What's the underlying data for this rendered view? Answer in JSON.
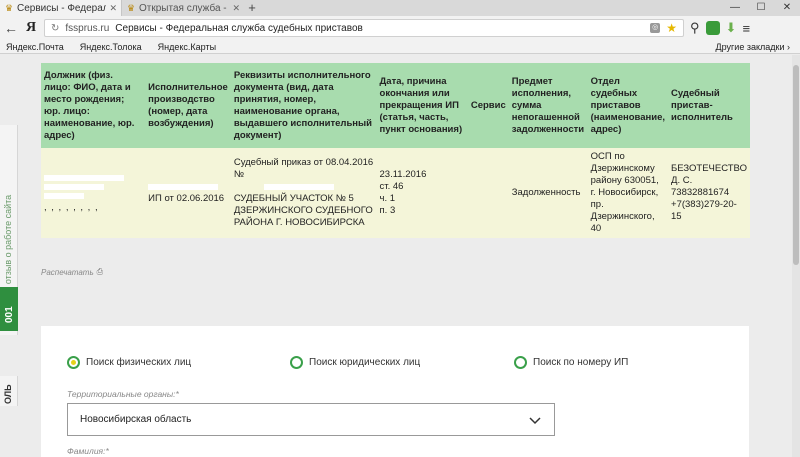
{
  "browser": {
    "tabs": [
      {
        "title": "Сервисы - Федеральная",
        "active": true
      },
      {
        "title": "Открытая служба - Федер",
        "active": false
      }
    ],
    "new_tab": "+",
    "window_controls": [
      "—",
      "☐",
      "✕"
    ],
    "address": {
      "domain": "fssprus.ru",
      "title": "Сервисы - Федеральная служба судебных приставов"
    },
    "bookmarks": [
      "Яндекс.Почта",
      "Яндекс.Толока",
      "Яндекс.Карты"
    ],
    "other_bookmarks": "Другие закладки"
  },
  "results": {
    "headers": [
      "Должник (физ. лицо: ФИО, дата и место рождения; юр. лицо: наименование, юр. адрес)",
      "Исполнительное производство (номер, дата возбуждения)",
      "Реквизиты исполнительного документа (вид, дата принятия, номер, наименование органа, выдавшего исполнительный документ)",
      "Дата, причина окончания или прекращения ИП (статья, часть, пункт основания)",
      "Сервис",
      "Предмет исполнения, сумма непогашенной задолженности",
      "Отдел судебных приставов (наименование, адрес)",
      "Судебный пристав-исполнитель"
    ],
    "row": {
      "debtor_tail": ", , , , , , , ,",
      "proceeding": "ИП от 02.06.2016",
      "document_line1": "Судебный приказ от 08.04.2016 №",
      "document_line2": "СУДЕБНЫЙ УЧАСТОК № 5 ДЗЕРЖИНСКОГО СУДЕБНОГО РАЙОНА Г. НОВОСИБИРСКА",
      "end_date": "23.11.2016",
      "end_article": "ст. 46",
      "end_part": "ч. 1",
      "end_point": "п. 3",
      "service": "",
      "subject": "Задолженность",
      "department": "ОСП по Дзержинскому району 630051, г. Новосибирск, пр. Дзержинского, 40",
      "bailiff": "БЕЗОТЕЧЕСТВО Д. С. 73832881674 +7(383)279-20-15"
    }
  },
  "print_label": "Распечатать",
  "feedback_tab": "Оставьте отзыв о работе сайта",
  "counter": "001",
  "vote_tab": "ОЛЬ",
  "search": {
    "radios": [
      {
        "label": "Поиск физических лиц",
        "selected": true
      },
      {
        "label": "Поиск юридических лиц",
        "selected": false
      },
      {
        "label": "Поиск по номеру ИП",
        "selected": false
      }
    ],
    "territory_label": "Территориальные органы:*",
    "territory_value": "Новосибирская область",
    "surname_label": "Фамилия:*"
  },
  "colors": {
    "header_green": "#a8dcae",
    "row_yellow": "#f4f5d9",
    "accent_green": "#2f8f3f"
  }
}
